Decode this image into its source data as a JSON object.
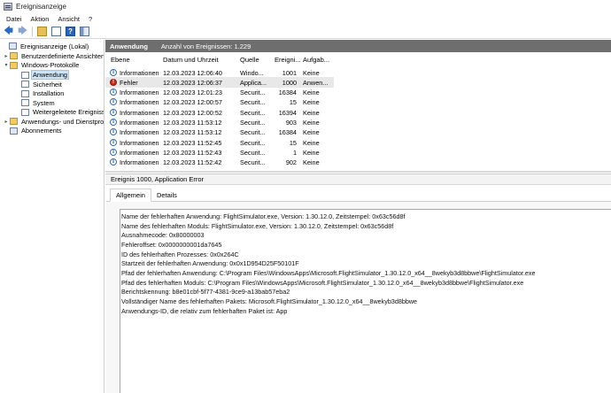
{
  "window": {
    "title": "Ereignisanzeige"
  },
  "menu": [
    "Datei",
    "Aktion",
    "Ansicht",
    "?"
  ],
  "toolbar": {
    "icons": [
      "back-arrow-icon",
      "forward-arrow-icon",
      "folder-icon",
      "properties-icon",
      "help-icon",
      "show-hide-pane-icon"
    ]
  },
  "tree": [
    {
      "label": "Ereignisanzeige (Lokal)",
      "level": 0,
      "expanded": null,
      "icon": "computer-icon"
    },
    {
      "label": "Benutzerdefinierte Ansichten",
      "level": 1,
      "expanded": false,
      "icon": "folder-icon"
    },
    {
      "label": "Windows-Protokolle",
      "level": 1,
      "expanded": true,
      "icon": "folder-icon"
    },
    {
      "label": "Anwendung",
      "level": 2,
      "expanded": null,
      "icon": "log-icon",
      "selected": true
    },
    {
      "label": "Sicherheit",
      "level": 2,
      "expanded": null,
      "icon": "log-icon"
    },
    {
      "label": "Installation",
      "level": 2,
      "expanded": null,
      "icon": "log-icon"
    },
    {
      "label": "System",
      "level": 2,
      "expanded": null,
      "icon": "log-icon"
    },
    {
      "label": "Weitergeleitete Ereignisse",
      "level": 2,
      "expanded": null,
      "icon": "log-icon"
    },
    {
      "label": "Anwendungs- und Dienstprot",
      "level": 1,
      "expanded": false,
      "icon": "folder-icon"
    },
    {
      "label": "Abonnements",
      "level": 1,
      "expanded": null,
      "icon": "subscription-icon"
    }
  ],
  "header": {
    "title": "Anwendung",
    "count": "Anzahl von Ereignissen: 1.229"
  },
  "columns": [
    "Ebene",
    "Datum und Uhrzeit",
    "Quelle",
    "Ereigni...",
    "Aufgab..."
  ],
  "events": [
    {
      "level": "Informationen",
      "kind": "info",
      "date": "12.03.2023 12:06:40",
      "source": "Windo...",
      "id": "1001",
      "task": "Keine"
    },
    {
      "level": "Fehler",
      "kind": "error",
      "date": "12.03.2023 12:06:37",
      "source": "Applica...",
      "id": "1000",
      "task": "Anwen...",
      "selected": true
    },
    {
      "level": "Informationen",
      "kind": "info",
      "date": "12.03.2023 12:01:23",
      "source": "Securit...",
      "id": "16384",
      "task": "Keine"
    },
    {
      "level": "Informationen",
      "kind": "info",
      "date": "12.03.2023 12:00:57",
      "source": "Securit...",
      "id": "15",
      "task": "Keine"
    },
    {
      "level": "Informationen",
      "kind": "info",
      "date": "12.03.2023 12:00:52",
      "source": "Securit...",
      "id": "16394",
      "task": "Keine"
    },
    {
      "level": "Informationen",
      "kind": "info",
      "date": "12.03.2023 11:53:12",
      "source": "Securit...",
      "id": "903",
      "task": "Keine"
    },
    {
      "level": "Informationen",
      "kind": "info",
      "date": "12.03.2023 11:53:12",
      "source": "Securit...",
      "id": "16384",
      "task": "Keine"
    },
    {
      "level": "Informationen",
      "kind": "info",
      "date": "12.03.2023 11:52:45",
      "source": "Securit...",
      "id": "15",
      "task": "Keine"
    },
    {
      "level": "Informationen",
      "kind": "info",
      "date": "12.03.2023 11:52:43",
      "source": "Securit...",
      "id": "1",
      "task": "Keine"
    },
    {
      "level": "Informationen",
      "kind": "info",
      "date": "12.03.2023 11:52:42",
      "source": "Securit...",
      "id": "902",
      "task": "Keine"
    }
  ],
  "detail": {
    "title": "Ereignis 1000, Application Error",
    "tabs": [
      "Allgemein",
      "Details"
    ],
    "active_tab": "Allgemein",
    "lines": [
      "Name der fehlerhaften Anwendung: FlightSimulator.exe, Version: 1.30.12.0, Zeitstempel: 0x63c56d8f",
      "Name des fehlerhaften Moduls: FlightSimulator.exe, Version: 1.30.12.0, Zeitstempel: 0x63c56d8f",
      "Ausnahmecode: 0x80000003",
      "Fehleroffset: 0x0000000001da7645",
      "ID des fehlerhaften Prozesses: 0x0x264C",
      "Startzeit der fehlerhaften Anwendung: 0x0x1D954D25F50101F",
      "Pfad der fehlerhaften Anwendung: C:\\Program Files\\WindowsApps\\Microsoft.FlightSimulator_1.30.12.0_x64__8wekyb3d8bbwe\\FlightSimulator.exe",
      "Pfad des fehlerhaften Moduls: C:\\Program Files\\WindowsApps\\Microsoft.FlightSimulator_1.30.12.0_x64__8wekyb3d8bbwe\\FlightSimulator.exe",
      "Berichtskennung: b8e01cbf-5f77-4381-9ce9-a13bab57eba2",
      "Vollständiger Name des fehlerhaften Pakets: Microsoft.FlightSimulator_1.30.12.0_x64__8wekyb3d8bbwe",
      "Anwendungs-ID, die relativ zum fehlerhaften Paket ist: App"
    ]
  }
}
